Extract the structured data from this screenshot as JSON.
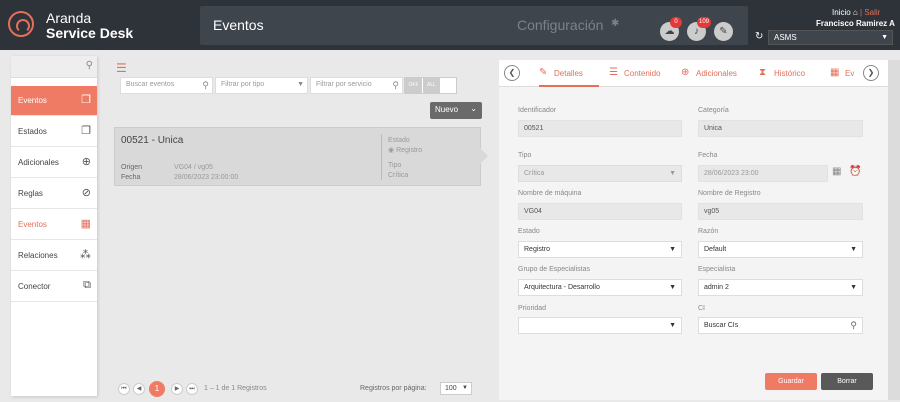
{
  "header": {
    "brand_line1": "Aranda",
    "brand_line2": "Service Desk",
    "title": "Eventos",
    "config": "Configuración",
    "notif1_count": "0",
    "notif2_count": "109",
    "inicio": "Inicio",
    "salir": "Salir",
    "user": "Francisco Ramirez A",
    "project": "ASMS"
  },
  "sidebar": {
    "items": [
      {
        "label": "Eventos",
        "icon": "copy-icon"
      },
      {
        "label": "Estados",
        "icon": "copy-icon"
      },
      {
        "label": "Adicionales",
        "icon": "plus-circle-icon"
      },
      {
        "label": "Reglas",
        "icon": "compass-icon"
      },
      {
        "label": "Eventos",
        "icon": "calendar-icon"
      },
      {
        "label": "Relaciones",
        "icon": "network-icon"
      },
      {
        "label": "Conector",
        "icon": "connector-icon"
      }
    ]
  },
  "filters": {
    "search_placeholder": "Buscar eventos",
    "type_placeholder": "Filtrar por tipo",
    "service_placeholder": "Filtrar por servicio",
    "toggle_off": "OFF",
    "toggle_all": "ALL",
    "new_button": "Nuevo"
  },
  "event_card": {
    "title": "00521 - Unica",
    "origin_label": "Origen",
    "origin_value": "VG04 / vg05",
    "date_label": "Fecha",
    "date_value": "28/06/2023 23:00:00",
    "state_label": "Estado",
    "state_value": "Registro",
    "type_label": "Tipo",
    "type_value": "Crítica"
  },
  "pager": {
    "current_page": "1",
    "info": "1 – 1 de 1 Registros",
    "per_page_label": "Registros por página:",
    "per_page_value": "100"
  },
  "tabs": [
    {
      "label": "Detalles"
    },
    {
      "label": "Contenido"
    },
    {
      "label": "Adicionales"
    },
    {
      "label": "Histórico"
    },
    {
      "label": "Ev"
    }
  ],
  "form": {
    "identificador_label": "Identificador",
    "identificador_value": "00521",
    "categoria_label": "Categoría",
    "categoria_value": "Unica",
    "tipo_label": "Tipo",
    "tipo_value": "Crítica",
    "fecha_label": "Fecha",
    "fecha_value": "28/06/2023 23:00",
    "maquina_label": "Nombre de máquina",
    "maquina_value": "VG04",
    "registro_label": "Nombre de Registro",
    "registro_value": "vg05",
    "estado_label": "Estado",
    "estado_value": "Registro",
    "razon_label": "Razón",
    "razon_value": "Default",
    "grupo_label": "Grupo de Especialistas",
    "grupo_value": "Arquitectura - Desarrollo",
    "especialista_label": "Especialista",
    "especialista_value": "admin 2",
    "prioridad_label": "Prioridad",
    "prioridad_value": "",
    "ci_label": "CI",
    "ci_placeholder": "Buscar CIs",
    "save_button": "Guardar",
    "delete_button": "Borrar"
  },
  "colors": {
    "accent": "#ef7b65",
    "topbar": "#2d3339"
  }
}
